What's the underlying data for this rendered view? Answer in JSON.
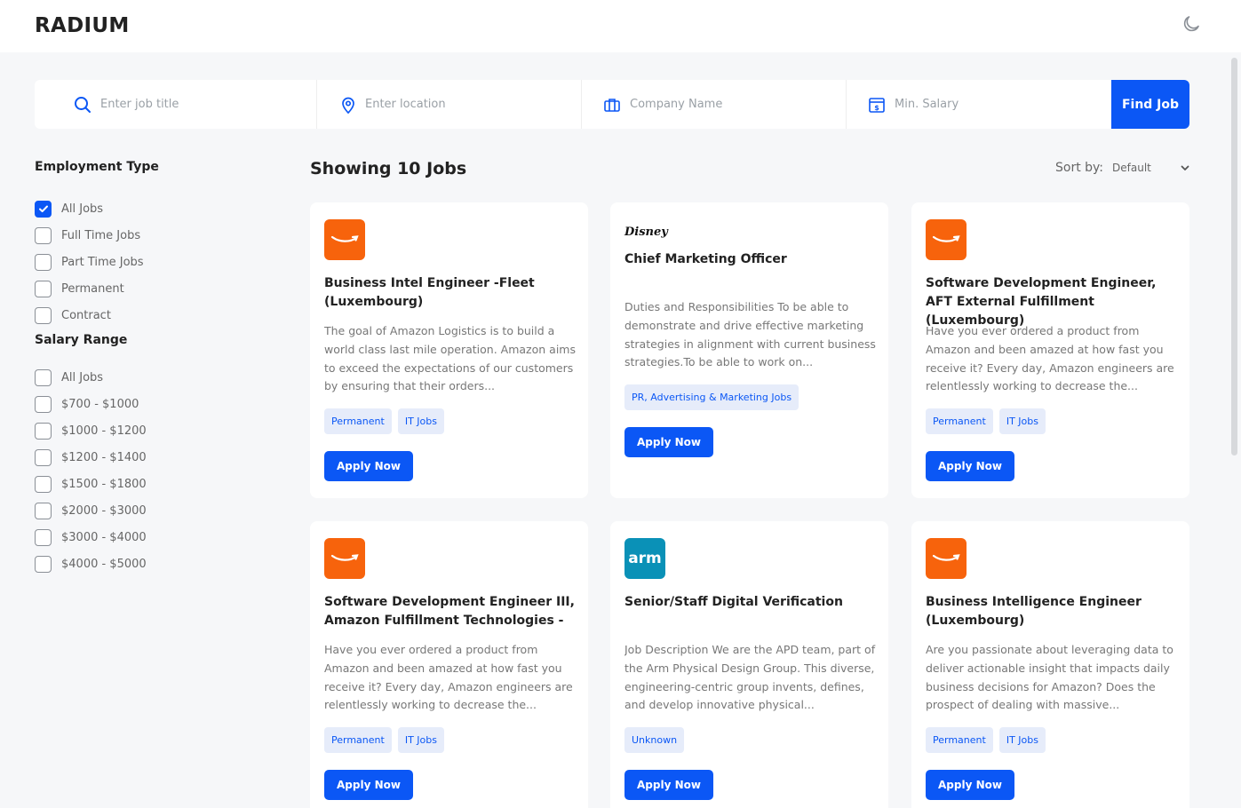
{
  "brand": "RADIUM",
  "search": {
    "job_placeholder": "Enter job title",
    "location_placeholder": "Enter location",
    "company_placeholder": "Company Name",
    "salary_placeholder": "Min. Salary",
    "find_label": "Find Job"
  },
  "filters": {
    "employment_title": "Employment Type",
    "employment": [
      "All Jobs",
      "Full Time Jobs",
      "Part Time Jobs",
      "Permanent",
      "Contract"
    ],
    "salary_title": "Salary Range",
    "salary": [
      "All Jobs",
      "$700 - $1000",
      "$1000 - $1200",
      "$1200 - $1400",
      "$1500 - $1800",
      "$2000 - $3000",
      "$3000 - $4000",
      "$4000 - $5000"
    ]
  },
  "results": {
    "showing": "Showing 10 Jobs",
    "sort_label": "Sort by:",
    "sort_value": "Default"
  },
  "jobs": [
    {
      "logo_text": "",
      "title": "Business Intel Engineer -Fleet (Luxembourg)",
      "description": "The goal of Amazon Logistics is to build a world class last mile operation. Amazon aims to exceed the expectations of our customers by ensuring that their orders...",
      "tags": [
        "Permanent",
        "IT Jobs"
      ],
      "apply": "Apply Now"
    },
    {
      "logo_text": "Disney",
      "title": "Chief Marketing Officer",
      "description": "Duties and Responsibilities To be able to demonstrate and drive effective marketing strategies in alignment with current business strategies.To be able to work on...",
      "tags": [
        "PR, Advertising & Marketing Jobs"
      ],
      "apply": "Apply Now"
    },
    {
      "logo_text": "",
      "title": "Software Development Engineer, AFT External Fulfillment (Luxembourg)",
      "description": "Have you ever ordered a product from Amazon and been amazed at how fast you receive it? Every day, Amazon engineers are relentlessly working to decrease the...",
      "tags": [
        "Permanent",
        "IT Jobs"
      ],
      "apply": "Apply Now"
    },
    {
      "logo_text": "",
      "title": "Software Development Engineer III, Amazon Fulfillment Technologies -",
      "description": "Have you ever ordered a product from Amazon and been amazed at how fast you receive it? Every day, Amazon engineers are relentlessly working to decrease the...",
      "tags": [
        "Permanent",
        "IT Jobs"
      ],
      "apply": "Apply Now"
    },
    {
      "logo_text": "arm",
      "title": "Senior/Staff Digital Verification",
      "description": "Job Description We are the APD team, part of the Arm Physical Design Group. This diverse, engineering-centric group invents, defines, and develop innovative physical...",
      "tags": [
        "Unknown"
      ],
      "apply": "Apply Now"
    },
    {
      "logo_text": "",
      "title": "Business Intelligence Engineer (Luxembourg)",
      "description": "Are you passionate about leveraging data to deliver actionable insight that impacts daily business decisions for Amazon? Does the prospect of dealing with massive...",
      "tags": [
        "Permanent",
        "IT Jobs"
      ],
      "apply": "Apply Now"
    }
  ],
  "colors": {
    "accent": "#0b57f5",
    "amazon_orange": "#f7630c",
    "arm_blue": "#0a91b7"
  },
  "icons": [
    "moon-icon",
    "search-icon",
    "location-pin-icon",
    "briefcase-icon",
    "salary-icon",
    "chevron-down-icon",
    "check-icon",
    "amazon-smile-icon"
  ]
}
